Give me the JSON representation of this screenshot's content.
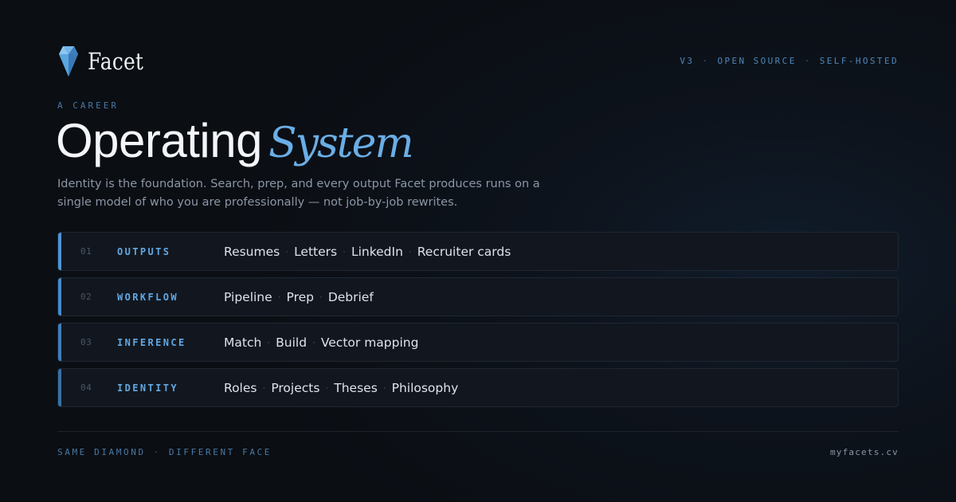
{
  "brand": {
    "name": "Facet",
    "logo_icon": "diamond-icon"
  },
  "meta": {
    "version": "V3",
    "open_source": "OPEN SOURCE",
    "self_hosted": "SELF-HOSTED",
    "separator": "·"
  },
  "hero": {
    "eyebrow": "A CAREER",
    "title_main": "Operating",
    "title_accent": "System",
    "lede": "Identity is the foundation. Search, prep, and every output Facet produces runs on a single model of who you are professionally — not job-by-job rewrites."
  },
  "rows": [
    {
      "num": "01",
      "label": "OUTPUTS",
      "items": [
        "Resumes",
        "Letters",
        "LinkedIn",
        "Recruiter cards"
      ]
    },
    {
      "num": "02",
      "label": "WORKFLOW",
      "items": [
        "Pipeline",
        "Prep",
        "Debrief"
      ]
    },
    {
      "num": "03",
      "label": "INFERENCE",
      "items": [
        "Match",
        "Build",
        "Vector mapping"
      ]
    },
    {
      "num": "04",
      "label": "IDENTITY",
      "items": [
        "Roles",
        "Projects",
        "Theses",
        "Philosophy"
      ]
    }
  ],
  "footer": {
    "tagline_a": "SAME DIAMOND",
    "tagline_b": "DIFFERENT FACE",
    "separator": "·",
    "url": "myfacets.cv"
  },
  "colors": {
    "accent": "#62a7e2",
    "title_accent": "#6aaee6",
    "background": "#0b0e13",
    "row_bg": "#12171f",
    "row_bars": [
      "#4d95d6",
      "#468bc9",
      "#3f7fba",
      "#3871a6"
    ]
  }
}
